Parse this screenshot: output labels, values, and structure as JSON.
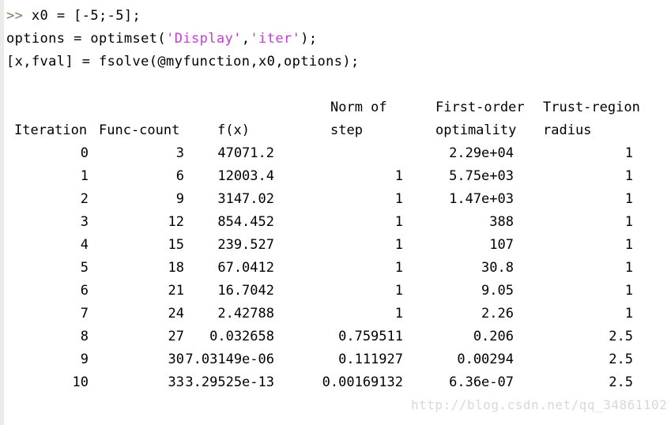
{
  "console": {
    "prompt_symbol": ">>",
    "prompt_color": "#7a7f55",
    "string_color": "#c03fd0",
    "text_color": "#000000",
    "background_color": "#ffffff",
    "gutter_color": "#ebebeb"
  },
  "commands": {
    "line1_before": " x0 = [-5;-5];",
    "line2_a": "options = optimset(",
    "line2_str1": "'Display'",
    "line2_b": ",",
    "line2_str2": "'iter'",
    "line2_c": ");",
    "line3": "[x,fval] = fsolve(@myfunction,x0,options);"
  },
  "table": {
    "header_top": {
      "iteration": "",
      "func_count": "",
      "fx": "",
      "step": "Norm of",
      "optimality": "First-order",
      "radius": "Trust-region"
    },
    "header_bottom": {
      "iteration": "Iteration",
      "func_count": "Func-count",
      "fx": "f(x)",
      "step": "step",
      "optimality": "optimality",
      "radius": "radius"
    },
    "rows": [
      {
        "iteration": "0",
        "func_count": "3",
        "fx": "47071.2",
        "step": "",
        "optimality": "2.29e+04",
        "radius": "1"
      },
      {
        "iteration": "1",
        "func_count": "6",
        "fx": "12003.4",
        "step": "1",
        "optimality": "5.75e+03",
        "radius": "1"
      },
      {
        "iteration": "2",
        "func_count": "9",
        "fx": "3147.02",
        "step": "1",
        "optimality": "1.47e+03",
        "radius": "1"
      },
      {
        "iteration": "3",
        "func_count": "12",
        "fx": "854.452",
        "step": "1",
        "optimality": "388",
        "radius": "1"
      },
      {
        "iteration": "4",
        "func_count": "15",
        "fx": "239.527",
        "step": "1",
        "optimality": "107",
        "radius": "1"
      },
      {
        "iteration": "5",
        "func_count": "18",
        "fx": "67.0412",
        "step": "1",
        "optimality": "30.8",
        "radius": "1"
      },
      {
        "iteration": "6",
        "func_count": "21",
        "fx": "16.7042",
        "step": "1",
        "optimality": "9.05",
        "radius": "1"
      },
      {
        "iteration": "7",
        "func_count": "24",
        "fx": "2.42788",
        "step": "1",
        "optimality": "2.26",
        "radius": "1"
      },
      {
        "iteration": "8",
        "func_count": "27",
        "fx": "0.032658",
        "step": "0.759511",
        "optimality": "0.206",
        "radius": "2.5"
      },
      {
        "iteration": "9",
        "func_count": "30",
        "fx": "7.03149e-06",
        "step": "0.111927",
        "optimality": "0.00294",
        "radius": "2.5"
      },
      {
        "iteration": "10",
        "func_count": "33",
        "fx": "3.29525e-13",
        "step": "0.00169132",
        "optimality": "6.36e-07",
        "radius": "2.5"
      }
    ]
  },
  "watermark": {
    "text": "http://blog.csdn.net/qq_34861102",
    "color": "#d8d8d8"
  }
}
